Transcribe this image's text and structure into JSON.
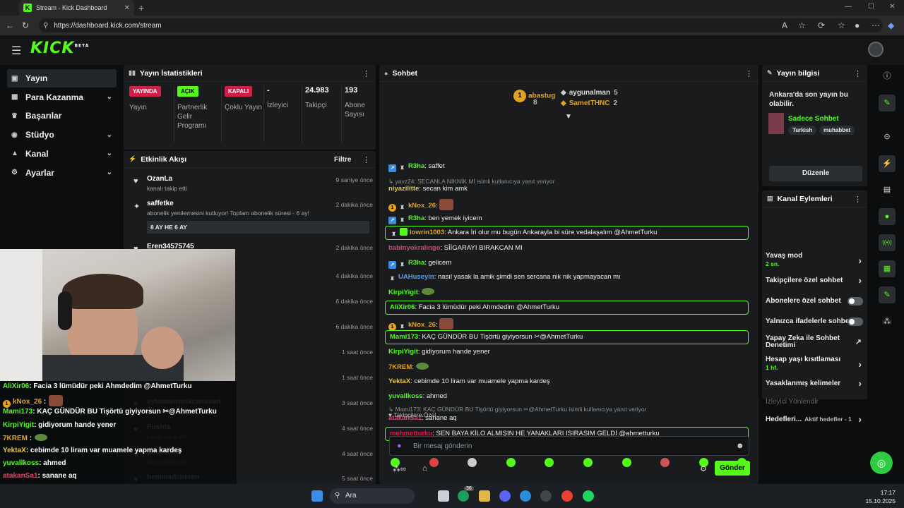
{
  "browser": {
    "tab_title": "Stream - Kick Dashboard",
    "url": "https://dashboard.kick.com/stream"
  },
  "app": {
    "logo": "KICK",
    "logo_badge": "BETA"
  },
  "sidebar": {
    "items": [
      {
        "label": "Yayın",
        "icon": "broadcast-icon",
        "active": true
      },
      {
        "label": "Para Kazanma",
        "icon": "money-icon",
        "chevron": true
      },
      {
        "label": "Başarılar",
        "icon": "trophy-icon"
      },
      {
        "label": "Stüdyo",
        "icon": "studio-icon",
        "chevron": true
      },
      {
        "label": "Kanal",
        "icon": "channel-icon",
        "chevron": true
      },
      {
        "label": "Ayarlar",
        "icon": "settings-icon",
        "chevron": true
      }
    ]
  },
  "stats": {
    "title": "Yayın İstatistikleri",
    "items": [
      {
        "badge": "YAYINDA",
        "label": "Yayın"
      },
      {
        "badge": "AÇIK",
        "label": "Partnerlik Gelir Programı"
      },
      {
        "badge": "KAPALI",
        "label": "Çoklu Yayın"
      },
      {
        "value": "-",
        "label": "İzleyici"
      },
      {
        "value": "24.983",
        "label": "Takipçi"
      },
      {
        "value": "193",
        "label": "Abone Sayısı"
      }
    ]
  },
  "activity": {
    "title": "Etkinlik Akışı",
    "filter_label": "Filtre",
    "items": [
      {
        "name": "OzanLa",
        "sub": "kanalı takip etti",
        "time": "9 saniye önce"
      },
      {
        "name": "saffetke",
        "sub": "abonelik yenilemesini kutluyor! Toplam abonelik süresi - 6 ay!",
        "time": "2 dakika önce",
        "tag": "8 AY HE 6 AY"
      },
      {
        "name": "Eren34575745",
        "sub": "",
        "time": "2 dakika önce"
      },
      {
        "time": "4 dakika önce"
      },
      {
        "time": "6 dakika önce"
      },
      {
        "time": "6 dakika önce"
      },
      {
        "time": "1 saat önce"
      },
      {
        "time": "1 saat önce"
      },
      {
        "name": "aytmatematikcanavari",
        "sub": "kanalı takip etti",
        "time": "3 saat önce"
      },
      {
        "name": "Pushta",
        "sub": "kanalı takip etti",
        "time": "4 saat önce"
      },
      {
        "name": "Sadesaliff",
        "sub": "kanalı takip etti",
        "time": "4 saat önce"
      },
      {
        "name": "benimadimeren",
        "sub": "",
        "time": "5 saat önce"
      }
    ]
  },
  "chat": {
    "title": "Sohbet",
    "leaderboard": [
      {
        "name": "abastug",
        "count": "8"
      },
      {
        "name": "aygunalman",
        "count": "5"
      },
      {
        "name": "SametTHNC",
        "count": "2"
      }
    ],
    "messages": [
      {
        "user": "R3ha",
        "color": "#53fc18",
        "text": "saffet",
        "badges": [
          "blue",
          "gray"
        ]
      },
      {
        "reply": "yavz24: SECANLA NİKNİK Mİ isimli kullanıcıya yanıt veriyor"
      },
      {
        "user": "niyazilitte",
        "color": "#e6c84a",
        "text": "secan kim amk"
      },
      {
        "user": "kNox_26",
        "color": "#e2a420",
        "text": "",
        "badges": [
          "gold",
          "gray"
        ],
        "emote": true
      },
      {
        "user": "R3ha",
        "color": "#53fc18",
        "text": "ben yemek iyicem",
        "badges": [
          "blue",
          "gray"
        ]
      },
      {
        "user": "lowrin1003",
        "color": "#e2a420",
        "text": "Ankara İri olur mu bugün Ankarayla bi süre vedalaşalım @AhmetTurku",
        "badges": [
          "gray",
          "green"
        ],
        "highlight": true
      },
      {
        "user": "babinyokralingo",
        "color": "#d04a6f",
        "text": "SİİGARAYI BIRAKCAN MI"
      },
      {
        "user": "R3ha",
        "color": "#53fc18",
        "text": "gelicem",
        "badges": [
          "blue",
          "gray"
        ]
      },
      {
        "user": "UAHuseyin",
        "color": "#5aa0e8",
        "text": "nasıl yasak la amik şimdi sen sercana nik nik yapmayacan mı",
        "badges": [
          "gray"
        ]
      },
      {
        "user": "KirpiYigit",
        "color": "#53fc18",
        "text": "",
        "frog": true
      },
      {
        "user": "AliXir06",
        "color": "#53fc18",
        "text": "Facia 3 lümüdür peki Ahmdedim @AhmetTurku",
        "highlight": true
      },
      {
        "user": "kNox_26",
        "color": "#e2a420",
        "text": "",
        "badges": [
          "gold",
          "gray"
        ],
        "emote": true
      },
      {
        "user": "Mami173",
        "color": "#53fc18",
        "text": "KAÇ GÜNDÜR BU Tişörtü giyiyorsun ✂@AhmetTurku",
        "highlight": true
      },
      {
        "user": "KirpiYigit",
        "color": "#53fc18",
        "text": "gidiyorum hande yener"
      },
      {
        "user": "7KREM",
        "color": "#e2a420",
        "text": "",
        "frog": true
      },
      {
        "user": "YektaX",
        "color": "#e6c84a",
        "text": "cebimde 10 liram var muamele yapma kardeş"
      },
      {
        "user": "yuvallkoss",
        "color": "#53fc18",
        "text": "ahmed"
      },
      {
        "reply": "Mami173: KAÇ GÜNDÜR BU Tişörtü giyiyorsun ✂@AhmetTurku isimli kullanıcıya yanıt veriyor"
      },
      {
        "user": "atakanSa1",
        "color": "#d04a6f",
        "text": "sanane aq"
      },
      {
        "user": "mehmetturku",
        "color": "#d21f4a",
        "text": "SEN BAYA KİLO ALMIŞIN HE YANAKLARI ISIRASIM GELDİ @ahmetturku",
        "highlight": true
      }
    ],
    "followers_only": "Takipçilere Özel",
    "input_placeholder": "Bir mesaj gönderin",
    "send_label": "Gönder"
  },
  "stream_info": {
    "title": "Yayın bilgisi",
    "stream_title": "Ankara'da son yayın bu olabilir.",
    "category": "Sadece Sohbet",
    "tags": [
      "Turkish",
      "muhabbet"
    ],
    "edit_label": "Düzenle"
  },
  "channel_actions": {
    "title": "Kanal Eylemleri",
    "items": [
      {
        "label": "Yavaş mod",
        "sub": "2 sn.",
        "kind": "chevron"
      },
      {
        "label": "Takipçilere özel sohbet",
        "kind": "chevron"
      },
      {
        "label": "Abonelere özel sohbet",
        "kind": "toggle"
      },
      {
        "label": "Yalnızca ifadelerle sohbet",
        "kind": "toggle"
      },
      {
        "label": "Yapay Zeka ile Sohbet Denetimi",
        "kind": "external"
      },
      {
        "label": "Hesap yaşı kısıtlaması",
        "sub": "1 hf.",
        "kind": "chevron"
      },
      {
        "label": "Yasaklanmış kelimeler",
        "kind": "chevron"
      },
      {
        "label": "İzleyici Yönlendir",
        "kind": "disabled"
      },
      {
        "label": "Hedefleri...",
        "sub": "Aktif hedefler - 1",
        "kind": "chevron"
      }
    ]
  },
  "overlay_chat": [
    {
      "user": "AliXir06",
      "color": "#53fc18",
      "text": ": Facia 3 lümüdür peki Ahmdedim @AhmetTurku"
    },
    {
      "user": "kNox_26",
      "color": "#e2a420",
      "text": " :"
    },
    {
      "user": "Mami173",
      "color": "#53fc18",
      "text": ": KAÇ GÜNDÜR BU Tişörtü giyiyorsun ✂@AhmetTurku"
    },
    {
      "user": "KirpiYigit",
      "color": "#53fc18",
      "text": ": gidiyorum hande yener"
    },
    {
      "user": "7KREM",
      "color": "#e2a420",
      "text": " :"
    },
    {
      "user": "YektaX",
      "color": "#e6c84a",
      "text": ": cebimde 10 liram var muamele yapma kardeş"
    },
    {
      "user": "yuvallkoss",
      "color": "#53fc18",
      "text": ": ahmed"
    },
    {
      "user": "atakanSa1",
      "color": "#d04a6f",
      "text": ": sanane aq"
    },
    {
      "user": "mehmetturku",
      "color": "#d21f4a",
      "text": ": SEN BAYA KİLO ALMIŞIN HE YANAKLARI ISIRASIM GELDİ"
    },
    {
      "user": "",
      "color": "#ffffff",
      "text": "@ahmetturku"
    }
  ],
  "taskbar": {
    "search_label": "Ara",
    "time": "17:17",
    "date": "15.10.2025",
    "badge_count": "36"
  },
  "colors": {
    "accent": "#53fc18",
    "live": "#d21f4a"
  }
}
